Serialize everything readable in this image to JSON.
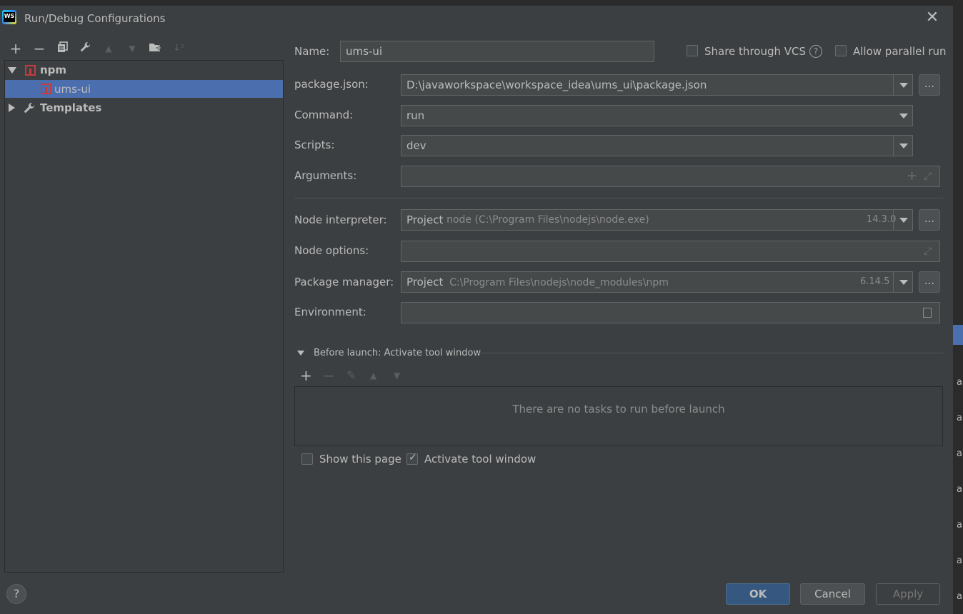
{
  "window": {
    "title": "Run/Debug Configurations",
    "app_icon": "WS"
  },
  "toolbar": {
    "icons": [
      "add-icon",
      "remove-icon",
      "copy-icon",
      "wrench-icon",
      "arrow-up-icon",
      "arrow-down-icon",
      "folder-add-icon",
      "sort-alpha-icon"
    ]
  },
  "tree": {
    "npm_label": "npm",
    "child_label": "ums-ui",
    "templates_label": "Templates"
  },
  "form": {
    "name_label": "Name:",
    "name_value": "ums-ui",
    "share_vcs_label": "Share through VCS",
    "allow_parallel_label": "Allow parallel run",
    "package_json_label": "package.json:",
    "package_json_value": "D:\\javaworkspace\\workspace_idea\\ums_ui\\package.json",
    "command_label": "Command:",
    "command_value": "run",
    "scripts_label": "Scripts:",
    "scripts_value": "dev",
    "arguments_label": "Arguments:",
    "arguments_value": "",
    "node_interpreter_label": "Node interpreter:",
    "node_interpreter_prefix": "Project",
    "node_interpreter_value": "node (C:\\Program Files\\nodejs\\node.exe)",
    "node_interpreter_version": "14.3.0",
    "node_options_label": "Node options:",
    "node_options_value": "",
    "package_manager_label": "Package manager:",
    "package_manager_prefix": "Project",
    "package_manager_value": "C:\\Program Files\\nodejs\\node_modules\\npm",
    "package_manager_version": "6.14.5",
    "environment_label": "Environment:",
    "environment_value": "",
    "dots": "..."
  },
  "before_launch": {
    "header": "Before launch: Activate tool window",
    "empty_text": "There are no tasks to run before launch",
    "show_page_label": "Show this page",
    "show_page_checked": false,
    "activate_tool_label": "Activate tool window",
    "activate_tool_checked": true
  },
  "buttons": {
    "ok": "OK",
    "cancel": "Cancel",
    "apply": "Apply",
    "help": "?"
  },
  "background": {
    "right_edge_text": "ar"
  }
}
